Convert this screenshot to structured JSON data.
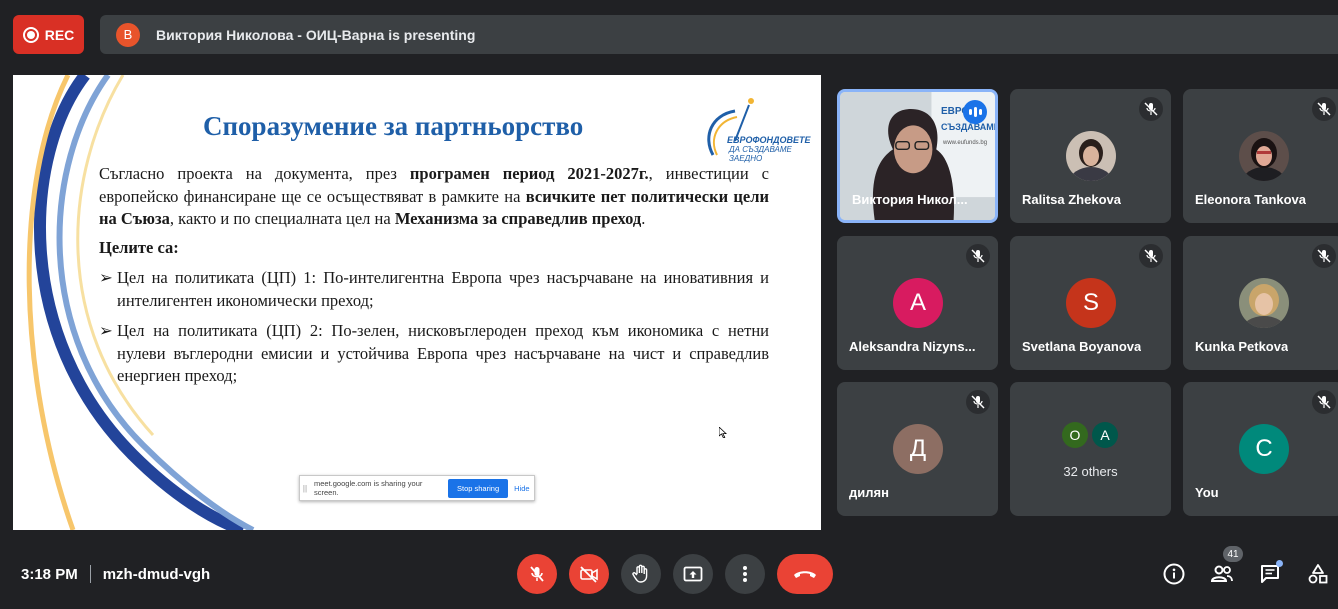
{
  "recording": {
    "label": "REC",
    "color": "#d93025"
  },
  "presenting_banner": {
    "initial": "B",
    "text": "Виктория Николова - ОИЦ-Варна is presenting"
  },
  "slide": {
    "title": "Споразумение за партньорство",
    "logo": {
      "line1": "ЕВРОФОНДОВЕТЕ",
      "line2": "ДА СЪЗДАВАМЕ ЗАЕДНО"
    },
    "intro": {
      "t1": "Съгласно проекта на документа, през ",
      "b1": "програмен период 2021-2027г.",
      "t2": ", инвестиции с европейско финансиране ще се осъществяват в рамките на ",
      "b2": "всичките пет политически цели на Съюза",
      "t3": ", както и по специалната цел на ",
      "b3": "Механизма за справедлив преход",
      "t4": "."
    },
    "goals_heading": "Целите са:",
    "goals": [
      "Цел на политиката (ЦП) 1: По-интелигентна Европа чрез насърчаване на иновативния и интелигентен икономически преход;",
      "Цел на политиката (ЦП) 2: По-зелен, нисковъглероден преход към икономика с нетни нулеви въглеродни емисии и устойчива Европа чрез насърчаване на чист и справедлив енергиен преход;"
    ],
    "share_bar": {
      "grip": "||",
      "message": "meet.google.com is sharing your screen.",
      "stop": "Stop sharing",
      "hide": "Hide"
    }
  },
  "presenter_tile": {
    "name": "Виктория Никол...",
    "backdrop_text_1": "ЕВРО",
    "backdrop_text_2": "СЪЗДАВАМЕ",
    "backdrop_text_3": "www.eufunds.bg"
  },
  "participants": [
    {
      "name": "Ralitsa Zhekova",
      "avatar": "photo"
    },
    {
      "name": "Eleonora Tankova",
      "avatar": "photo"
    },
    {
      "name": "Aleksandra Nizyns...",
      "initial": "A",
      "color": "#d81b60"
    },
    {
      "name": "Svetlana Boyanova",
      "initial": "S",
      "color": "#c5341b"
    },
    {
      "name": "Kunka Petkova",
      "avatar": "photo"
    },
    {
      "name": "дилян",
      "initial": "Д",
      "color": "#8d6e63"
    },
    {
      "name": "You",
      "initial": "C",
      "color": "#00897b"
    }
  ],
  "others": {
    "label": "32 others",
    "avatars": [
      {
        "initial": "О",
        "color": "#33691e"
      },
      {
        "initial": "А",
        "color": "#00574b"
      }
    ]
  },
  "bottom": {
    "time": "3:18 PM",
    "meeting_code": "mzh-dmud-vgh",
    "people_count": "41"
  }
}
